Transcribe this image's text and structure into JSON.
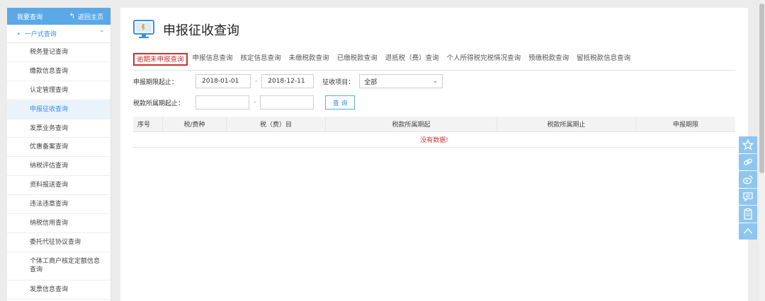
{
  "sidebar": {
    "header_title": "我要查询",
    "home_label": "返回主页",
    "group_label": "一户式查询",
    "items": [
      {
        "label": "税务登记查询"
      },
      {
        "label": "缴款信息查询"
      },
      {
        "label": "认定管理查询"
      },
      {
        "label": "申报征收查询"
      },
      {
        "label": "发票业务查询"
      },
      {
        "label": "优惠备案查询"
      },
      {
        "label": "纳税评估查询"
      },
      {
        "label": "资料报送查询"
      },
      {
        "label": "违法违章查询"
      },
      {
        "label": "纳税信用查询"
      },
      {
        "label": "委托代征协议查询"
      },
      {
        "label": "个体工商户核定定额信息查询"
      },
      {
        "label": "发票信息查询"
      }
    ],
    "active_item": "申报征收查询"
  },
  "main": {
    "title": "申报征收查询",
    "tabs": [
      {
        "label": "逾期未申报查询"
      },
      {
        "label": "申报信息查询"
      },
      {
        "label": "核定信息查询"
      },
      {
        "label": "未缴税款查询"
      },
      {
        "label": "已缴税款查询"
      },
      {
        "label": "退抵税（费）查询"
      },
      {
        "label": "个人所得税完税情况查询"
      },
      {
        "label": "预缴税款查询"
      },
      {
        "label": "留抵税款信息查询"
      }
    ],
    "form": {
      "period_label": "申报期限起止：",
      "period_start": "2018-01-01",
      "period_sep": "-",
      "period_end": "2018-12-11",
      "project_label": "征收项目：",
      "project_value": "全部",
      "tax_period_label": "税款所属期起止：",
      "tax_period_start": "",
      "tax_period_sep": "-",
      "tax_period_end": "",
      "query_button": "查 询"
    },
    "table": {
      "headers": [
        "序号",
        "税/费种",
        "税（费）目",
        "税款所属期起",
        "税款所属期止",
        "申报期限"
      ],
      "empty_text": "没有数据!"
    }
  },
  "colors": {
    "accent": "#5aa9e6",
    "link": "#3a8ee6",
    "active_tab_border": "#c8322d",
    "no_data": "#d32f2f",
    "float_button": "#8ec6ef"
  },
  "float_toolbar": [
    {
      "icon": "star-icon"
    },
    {
      "icon": "link-icon"
    },
    {
      "icon": "weibo-icon"
    },
    {
      "icon": "message-icon"
    },
    {
      "icon": "clipboard-icon"
    },
    {
      "icon": "chevron-up-icon"
    }
  ]
}
